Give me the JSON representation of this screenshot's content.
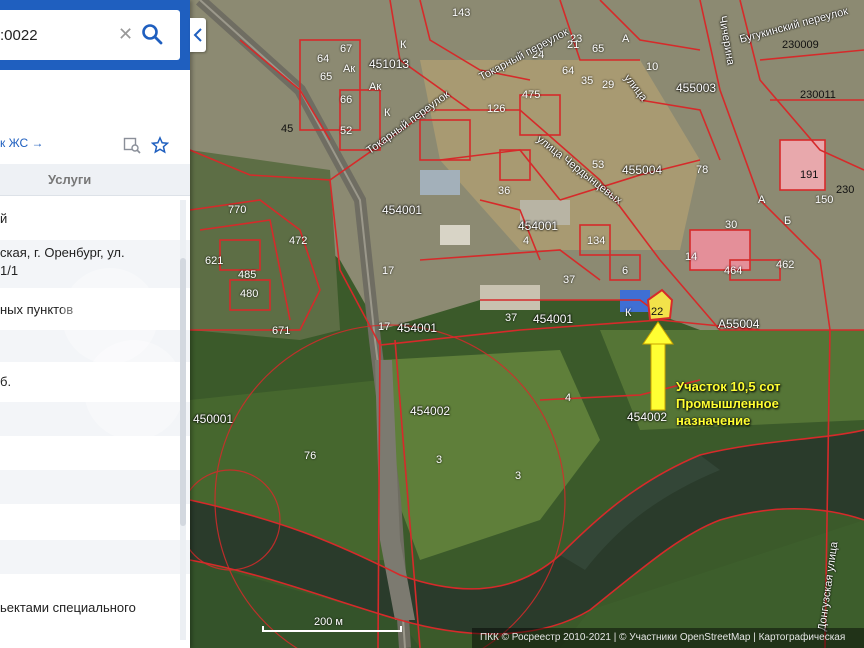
{
  "search": {
    "value": ":0022"
  },
  "panel": {
    "link_text": "к ЖС →",
    "tab_services": "Услуги",
    "rows": [
      "й",
      "ская, г. Оренбург, ул.",
      "1/1",
      "ных пунктов",
      "б.",
      "ьектами специального"
    ]
  },
  "icons": {
    "clear": "close-icon",
    "search": "search-icon",
    "collapse": "chevron-left-icon",
    "map_search": "map-search-icon",
    "favorite": "star-icon"
  },
  "map": {
    "blocks": [
      "451013",
      "455003",
      "455004",
      "454001",
      "454001",
      "454001",
      "454001",
      "454002",
      "454002",
      "450001",
      "230009",
      "230011",
      "230",
      "A55004"
    ],
    "plots": [
      "67",
      "64",
      "65",
      "66",
      "52",
      "45",
      "24",
      "65",
      "23",
      "475",
      "21",
      "64",
      "35",
      "29",
      "143",
      "10",
      "191",
      "150",
      "53",
      "36",
      "126",
      "134",
      "6",
      "37",
      "37",
      "17",
      "17",
      "4",
      "4",
      "3",
      "3",
      "76",
      "770",
      "621",
      "472",
      "485",
      "480",
      "671",
      "464",
      "462",
      "14",
      "30",
      "22",
      "78"
    ],
    "markers": [
      "К",
      "Ак",
      "К",
      "Ак",
      "А",
      "Б",
      "А",
      "К"
    ],
    "streets": [
      "Токарный переулок",
      "Токарный переулок",
      "улица Чердынцевых",
      "Бугукинский переулок",
      "Донгузская улица",
      "Чичерина",
      "улица"
    ],
    "annotation": [
      "Участок 10,5 сот",
      "Промышленное",
      "назначение"
    ],
    "arrow_color": "#ffff33",
    "boundary_color": "#d62a2a"
  },
  "scale": {
    "label": "200 м"
  },
  "attribution": "ПКК © Росреестр 2010-2021 | © Участники OpenStreetMap | Картографическая"
}
